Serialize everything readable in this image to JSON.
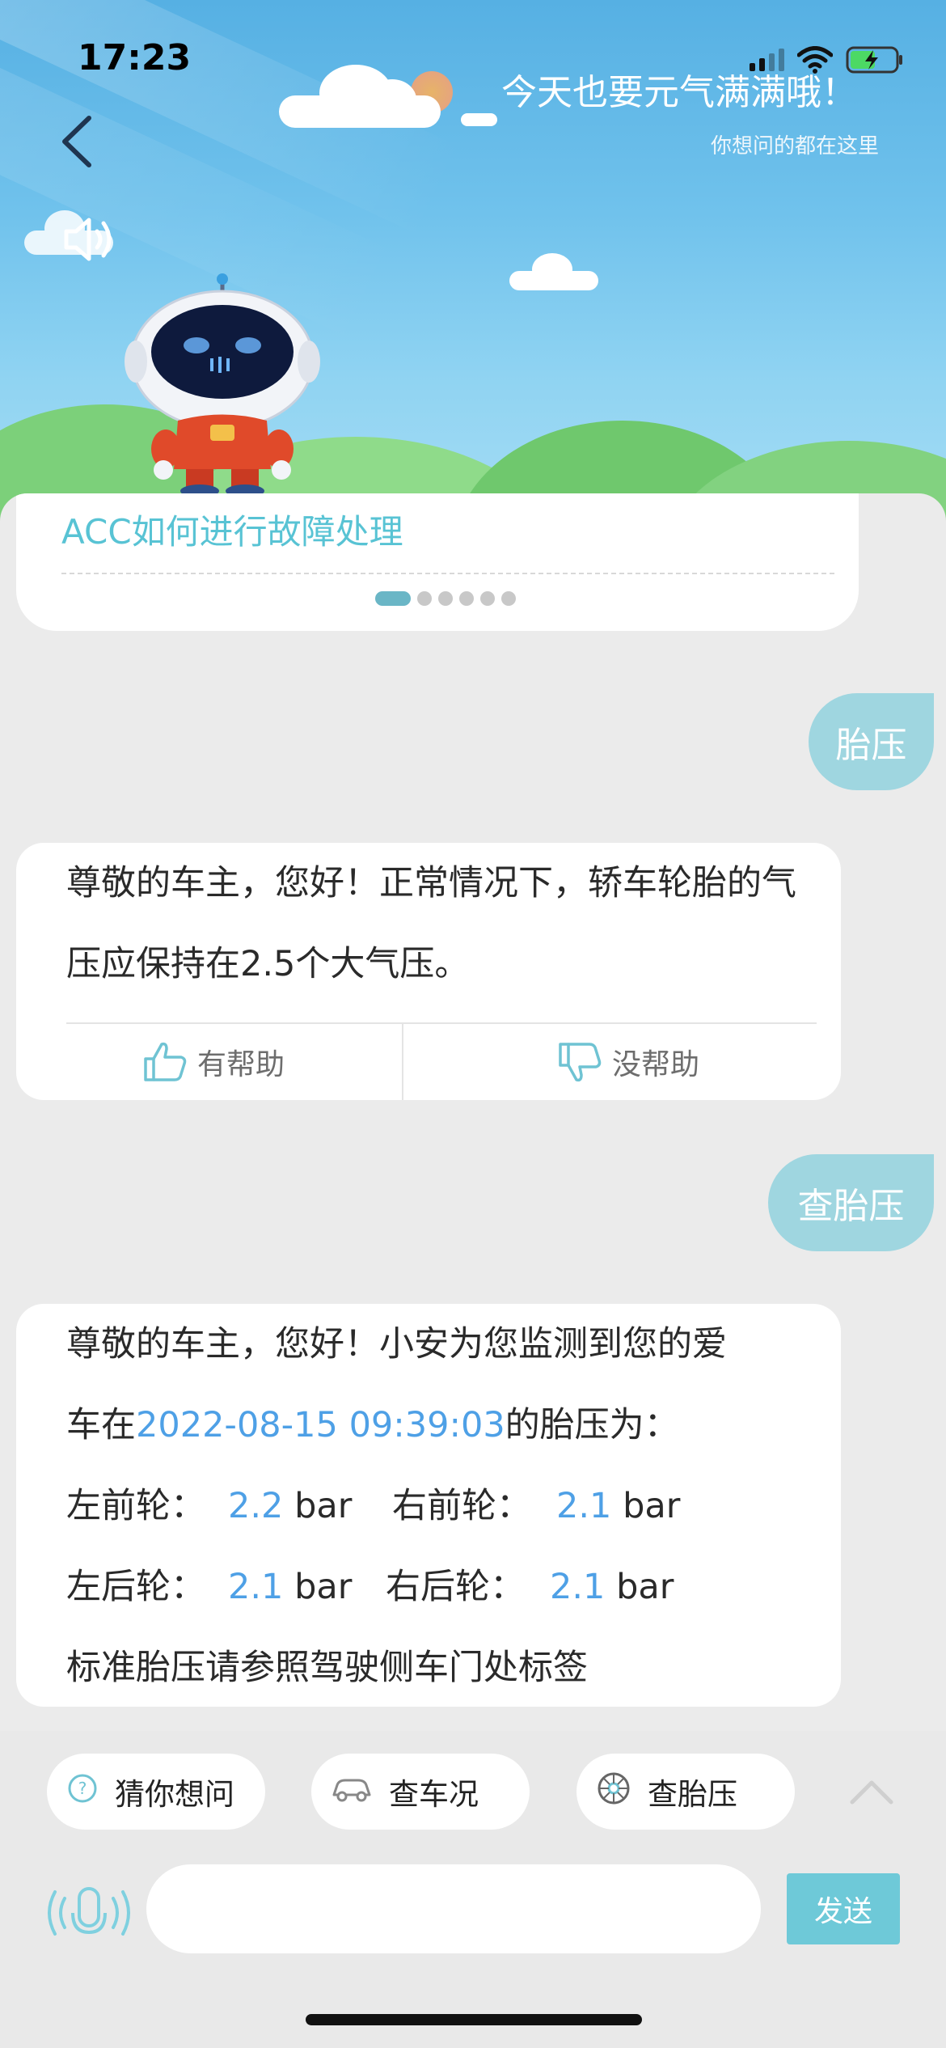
{
  "status_bar": {
    "time": "17:23"
  },
  "banner": {
    "title": "今天也要元气满满哦！",
    "subtitle": "你想问的都在这里"
  },
  "previous_card": {
    "link_text": "ACC如何进行故障处理",
    "dot_count": 6
  },
  "messages": {
    "user1": "胎压",
    "answer1": {
      "text": "尊敬的车主，您好！正常情况下，轿车轮胎的气压应保持在2.5个大气压。"
    },
    "feedback": {
      "helpful": "有帮助",
      "not_helpful": "没帮助"
    },
    "user2": "查胎压",
    "answer2": {
      "line1": "尊敬的车主，您好！小安为您监测到您的爱",
      "line2_prefix": "车在",
      "timestamp": "2022-08-15 09:39:03",
      "line2_suffix": "的胎压为：",
      "front_left_label": "左前轮：",
      "front_left_value": "2.2",
      "front_right_label": "右前轮：",
      "front_right_value": "2.1",
      "rear_left_label": "左后轮：",
      "rear_left_value": "2.1",
      "rear_right_label": "右后轮：",
      "rear_right_value": "2.1",
      "unit": "bar",
      "note": "标准胎压请参照驾驶侧车门处标签"
    }
  },
  "quick_actions": [
    {
      "label": "猜你想问",
      "icon": "question-icon"
    },
    {
      "label": "查车况",
      "icon": "car-icon"
    },
    {
      "label": "查胎压",
      "icon": "tire-icon"
    }
  ],
  "composer": {
    "input_value": "",
    "input_placeholder": "",
    "send_label": "发送"
  },
  "colors": {
    "accent": "#6ec9d8",
    "bubble": "#9fd6e0",
    "highlight": "#4ea0e6",
    "link": "#58c3d4"
  }
}
